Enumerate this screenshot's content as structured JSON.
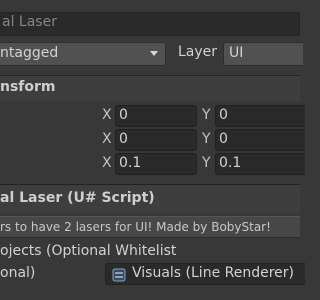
{
  "component_name_field": {
    "value": "al Laser"
  },
  "tag": {
    "value": "ntagged"
  },
  "layer": {
    "label": "Layer",
    "value": "UI"
  },
  "transform": {
    "title": "nsform",
    "rows": [
      {
        "x_label": "X",
        "x_value": "0",
        "y_label": "Y",
        "y_value": "0"
      },
      {
        "x_label": "X",
        "x_value": "0",
        "y_label": "Y",
        "y_value": "0"
      },
      {
        "x_label": "X",
        "x_value": "0.1",
        "y_label": "Y",
        "y_value": "0.1"
      }
    ]
  },
  "script_component": {
    "title": "al Laser (U# Script)",
    "info_text": "rs to have 2 lasers for UI! Made by BobyStar!"
  },
  "objects": {
    "header": "ojects (Optional Whitelist",
    "field_label": "onal)",
    "field_value": "Visuals (Line Renderer)",
    "field_icon": "line-renderer-icon"
  },
  "colors": {
    "background": "#383838",
    "field_bg": "#2a2a2a",
    "dropdown_bg": "#515151",
    "text": "#d2d2d2"
  }
}
